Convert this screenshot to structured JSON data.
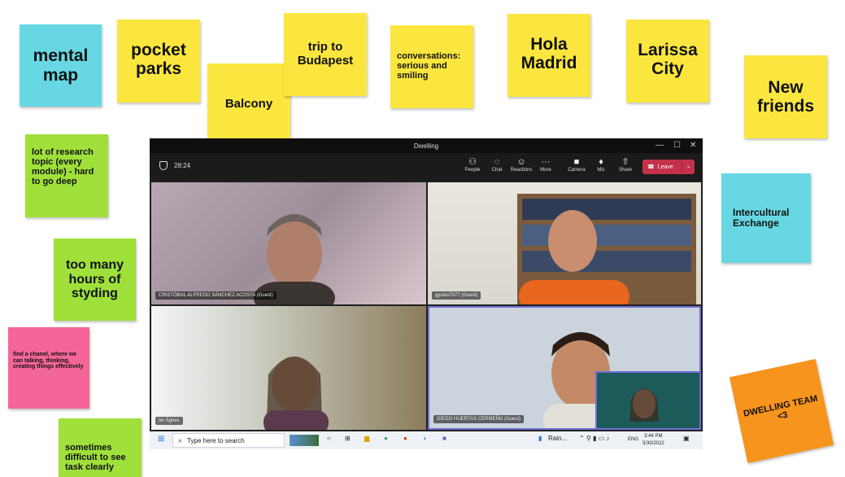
{
  "notes": {
    "mental_map": "mental map",
    "pocket_parks": "pocket parks",
    "balcony": "Balcony",
    "trip_budapest": "trip to Budapest",
    "conversations": "conversations: serious and smiling",
    "hola_madrid": "Hola Madrid",
    "larissa_city": "Larissa City",
    "new_friends": "New friends",
    "research_topic": "lot of research topic (every module) - hard to go deep",
    "too_many_hours": "too many hours of styding",
    "intercultural": "Intercultural Exchange",
    "find_channel": "find a chanel, where we can talking, thinking, creating things effectively",
    "dwelling_team": "DWELLING TEAM <3",
    "sometimes": "sometimes difficult to see task clearly"
  },
  "teams": {
    "window_title": "Dwelling",
    "timer": "28:24",
    "toolbar": {
      "people": "People",
      "chat": "Chat",
      "reactions": "Reactions",
      "more": "More",
      "camera": "Camera",
      "mic": "Mic",
      "share": "Share",
      "leave": "Leave"
    },
    "participants": {
      "p1": "CRISTÓBAL ALFREDO SÁNCHEZ ACOSTA (Guest)",
      "p2": "gyulas7077 (Guest)",
      "p3": "ter Ágnes",
      "p4": "DIEGO HUERTAS CERMEÑO (Guest)"
    }
  },
  "taskbar": {
    "search_placeholder": "Type here to search",
    "weather": "Rain...",
    "lang": "ENG",
    "time": "3:44 PM",
    "date": "5/30/2022"
  },
  "colors": {
    "cyan": "#67d8e3",
    "yellow": "#fbe63f",
    "green": "#9fe03a",
    "pink": "#f4669a",
    "orange": "#f7941d"
  }
}
